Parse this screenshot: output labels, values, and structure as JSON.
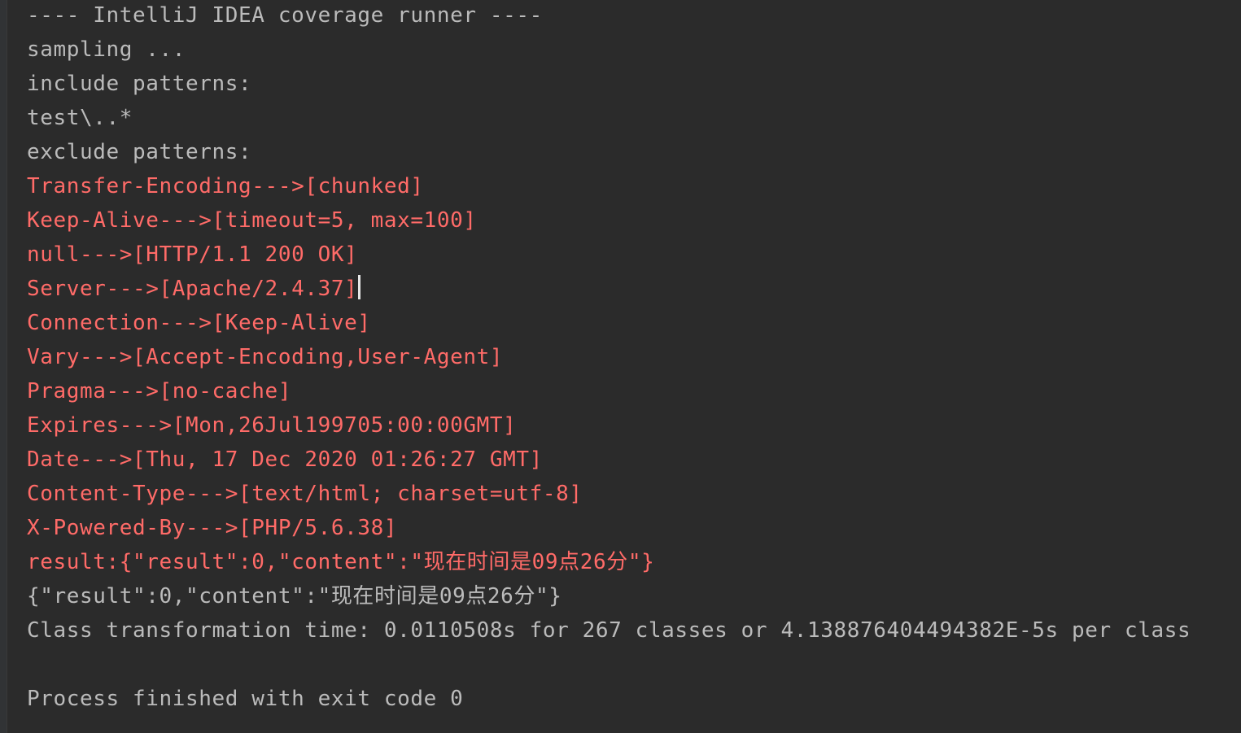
{
  "console": {
    "colors": {
      "background": "#2b2b2b",
      "stdout": "#bbbbbb",
      "stderr": "#ff6b68",
      "caret": "#e6e6e6"
    },
    "lines": [
      {
        "text": "---- IntelliJ IDEA coverage runner ----",
        "stream": "stdout"
      },
      {
        "text": "sampling ...",
        "stream": "stdout"
      },
      {
        "text": "include patterns:",
        "stream": "stdout"
      },
      {
        "text": "test\\..*",
        "stream": "stdout"
      },
      {
        "text": "exclude patterns:",
        "stream": "stdout"
      },
      {
        "text": "Transfer-Encoding--->[chunked]",
        "stream": "stderr"
      },
      {
        "text": "Keep-Alive--->[timeout=5, max=100]",
        "stream": "stderr"
      },
      {
        "text": "null--->[HTTP/1.1 200 OK]",
        "stream": "stderr"
      },
      {
        "text": "Server--->[Apache/2.4.37]",
        "stream": "stderr"
      },
      {
        "text": "Connection--->[Keep-Alive]",
        "stream": "stderr"
      },
      {
        "text": "Vary--->[Accept-Encoding,User-Agent]",
        "stream": "stderr"
      },
      {
        "text": "Pragma--->[no-cache]",
        "stream": "stderr"
      },
      {
        "text": "Expires--->[Mon,26Jul199705:00:00GMT]",
        "stream": "stderr"
      },
      {
        "text": "Date--->[Thu, 17 Dec 2020 01:26:27 GMT]",
        "stream": "stderr"
      },
      {
        "text": "Content-Type--->[text/html; charset=utf-8]",
        "stream": "stderr"
      },
      {
        "text": "X-Powered-By--->[PHP/5.6.38]",
        "stream": "stderr"
      },
      {
        "text": "result:{\"result\":0,\"content\":\"现在时间是09点26分\"}",
        "stream": "stderr"
      },
      {
        "text": "{\"result\":0,\"content\":\"现在时间是09点26分\"}",
        "stream": "stdout"
      },
      {
        "text": "Class transformation time: 0.0110508s for 267 classes or 4.138876404494382E-5s per class",
        "stream": "stdout"
      },
      {
        "text": "",
        "stream": "stdout"
      },
      {
        "text": "Process finished with exit code 0",
        "stream": "stdout"
      }
    ]
  }
}
